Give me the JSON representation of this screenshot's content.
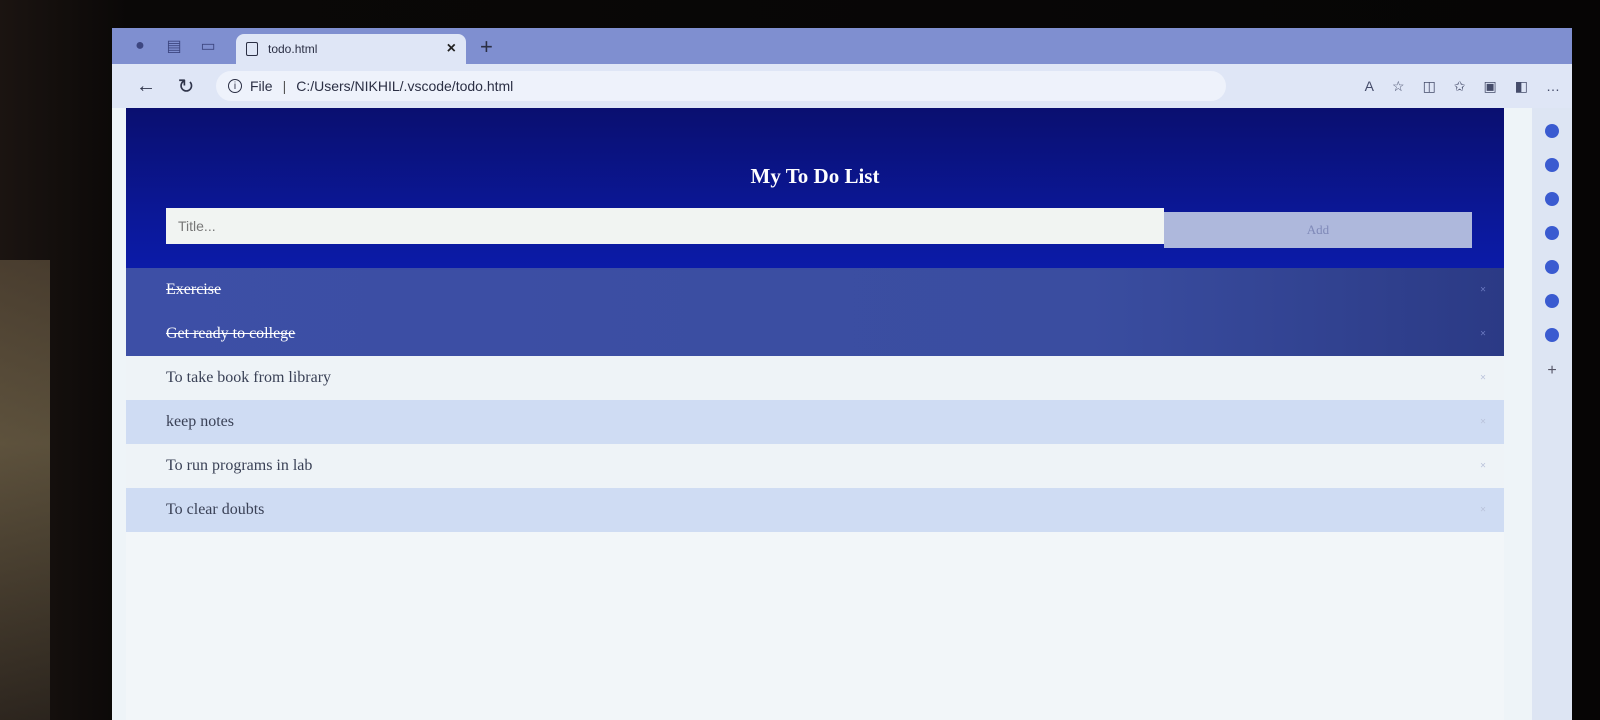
{
  "browser": {
    "tab_title": "todo.html",
    "tab_close": "×",
    "new_tab": "+",
    "back": "←",
    "reload": "↻",
    "info": "i",
    "address_scheme": "File",
    "address_sep": "|",
    "address_path": "C:/Users/NIKHIL/.vscode/todo.html"
  },
  "header": {
    "title": "My To Do List",
    "input_placeholder": "Title...",
    "add_label": "Add"
  },
  "todos": [
    {
      "text": "Exercise",
      "checked": true
    },
    {
      "text": "Get ready to college",
      "checked": true
    },
    {
      "text": "To take book from library",
      "checked": false
    },
    {
      "text": "keep notes",
      "checked": false
    },
    {
      "text": "To run programs in lab",
      "checked": false
    },
    {
      "text": "To clear doubts",
      "checked": false
    }
  ],
  "remove_glyph": "×",
  "colors": {
    "header": "#0b1899",
    "checked_item": "#3d4fa6",
    "add_button": "#aeb8dc",
    "stripe": "#cfdcf3"
  }
}
